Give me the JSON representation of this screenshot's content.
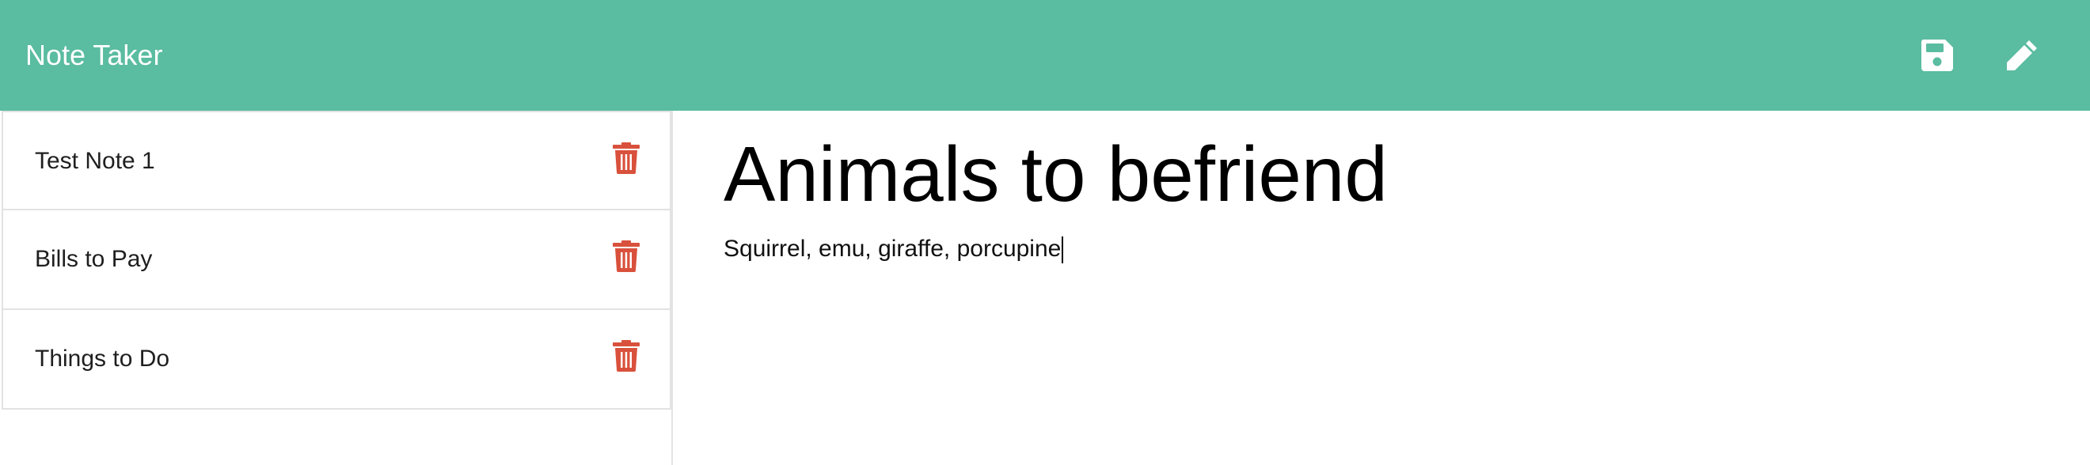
{
  "app": {
    "title": "Note Taker"
  },
  "toolbar": {
    "save_icon": "save-icon",
    "edit_icon": "pencil-icon"
  },
  "sidebar": {
    "notes": [
      {
        "title": "Test Note 1",
        "delete_icon": "trash-icon"
      },
      {
        "title": "Bills to Pay",
        "delete_icon": "trash-icon"
      },
      {
        "title": "Things to Do",
        "delete_icon": "trash-icon"
      }
    ]
  },
  "editor": {
    "title_value": "Animals to befriend",
    "body_value": "Squirrel, emu, giraffe, porcupine"
  },
  "colors": {
    "header": "#5abca0",
    "delete": "#d9513c",
    "text": "#000000"
  }
}
